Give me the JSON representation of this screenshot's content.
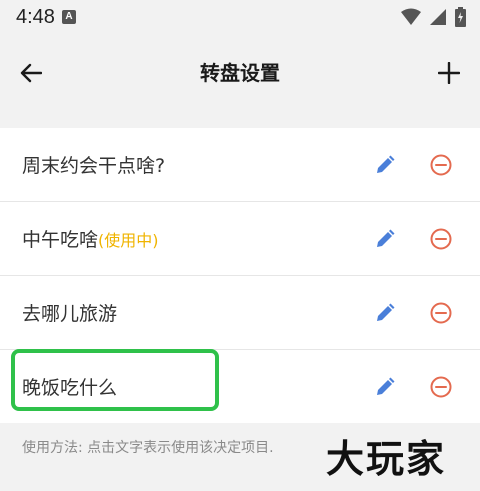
{
  "status_bar": {
    "time": "4:48",
    "notif_letter": "A"
  },
  "app_bar": {
    "title": "转盘设置"
  },
  "wheels": [
    {
      "name": "周末约会干点啥?",
      "tag": ""
    },
    {
      "name": "中午吃啥",
      "tag": "(使用中)"
    },
    {
      "name": "去哪儿旅游",
      "tag": ""
    },
    {
      "name": "晚饭吃什么",
      "tag": ""
    }
  ],
  "footer": {
    "hint": "使用方法: 点击文字表示使用该决定项目.",
    "watermark": "大玩家"
  },
  "colors": {
    "edit_icon": "#4a7fd9",
    "remove_icon": "#e46a4f",
    "in_use": "#f0b400",
    "highlight": "#2fc14a"
  }
}
